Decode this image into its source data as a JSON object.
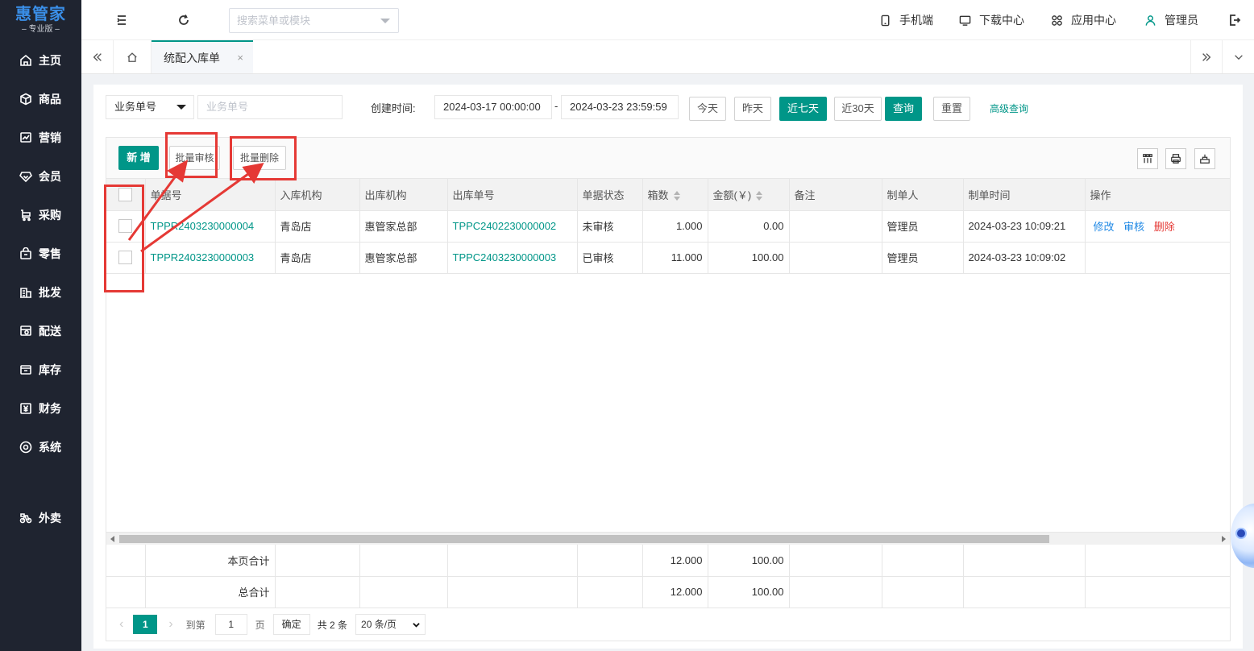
{
  "logo": {
    "main": "惠管家",
    "sub": "– 专业版 –"
  },
  "sidebar": {
    "items": [
      {
        "label": "主页",
        "icon": "home-icon"
      },
      {
        "label": "商品",
        "icon": "box-icon"
      },
      {
        "label": "营销",
        "icon": "chart-icon"
      },
      {
        "label": "会员",
        "icon": "diamond-icon"
      },
      {
        "label": "采购",
        "icon": "cart-icon"
      },
      {
        "label": "零售",
        "icon": "bag-icon"
      },
      {
        "label": "批发",
        "icon": "building-icon"
      },
      {
        "label": "配送",
        "icon": "truck-icon"
      },
      {
        "label": "库存",
        "icon": "archive-icon"
      },
      {
        "label": "财务",
        "icon": "yen-icon"
      },
      {
        "label": "系统",
        "icon": "gear-icon"
      },
      {
        "label": "外卖",
        "icon": "bike-icon"
      }
    ]
  },
  "topbar": {
    "search_placeholder": "搜索菜单或模块",
    "mobile": "手机端",
    "download": "下载中心",
    "apps": "应用中心",
    "user": "管理员"
  },
  "tabs": {
    "active": "统配入库单",
    "close": "×"
  },
  "filter": {
    "field_select": "业务单号",
    "field_placeholder": "业务单号",
    "created_label": "创建时间:",
    "start": "2024-03-17 00:00:00",
    "sep": "-",
    "end": "2024-03-23 23:59:59",
    "today": "今天",
    "yesterday": "昨天",
    "last7": "近七天",
    "last30": "近30天",
    "query": "查询",
    "reset": "重置",
    "advanced": "高级查询"
  },
  "toolbar": {
    "add": "新 增",
    "batch_audit": "批量审核",
    "batch_delete": "批量删除"
  },
  "table": {
    "headers": [
      "单据号",
      "入库机构",
      "出库机构",
      "出库单号",
      "单据状态",
      "箱数",
      "金额(￥)",
      "备注",
      "制单人",
      "制单时间",
      "操作"
    ],
    "rows": [
      {
        "doc": "TPPR2403230000004",
        "in_org": "青岛店",
        "out_org": "惠管家总部",
        "out_no": "TPPC2402230000002",
        "status": "未审核",
        "boxes": "1.000",
        "amount": "0.00",
        "remark": "",
        "maker": "管理员",
        "time": "2024-03-23 10:09:21",
        "actions": [
          "修改",
          "审核",
          "删除"
        ]
      },
      {
        "doc": "TPPR2403230000003",
        "in_org": "青岛店",
        "out_org": "惠管家总部",
        "out_no": "TPPC2403230000003",
        "status": "已审核",
        "boxes": "11.000",
        "amount": "100.00",
        "remark": "",
        "maker": "管理员",
        "time": "2024-03-23 10:09:02",
        "actions": []
      }
    ],
    "page_total_label": "本页合计",
    "page_total_boxes": "12.000",
    "page_total_amount": "100.00",
    "grand_total_label": "总合计",
    "grand_total_boxes": "12.000",
    "grand_total_amount": "100.00"
  },
  "pager": {
    "current": "1",
    "goto_label": "到第",
    "goto_value": "1",
    "page_unit": "页",
    "confirm": "确定",
    "total": "共 2 条",
    "page_size": "20 条/页"
  },
  "colors": {
    "sidebar": "#1f2430",
    "primary": "#009688",
    "link_blue": "#1e88e5",
    "danger": "#e53935",
    "annotation": "#e53935"
  }
}
